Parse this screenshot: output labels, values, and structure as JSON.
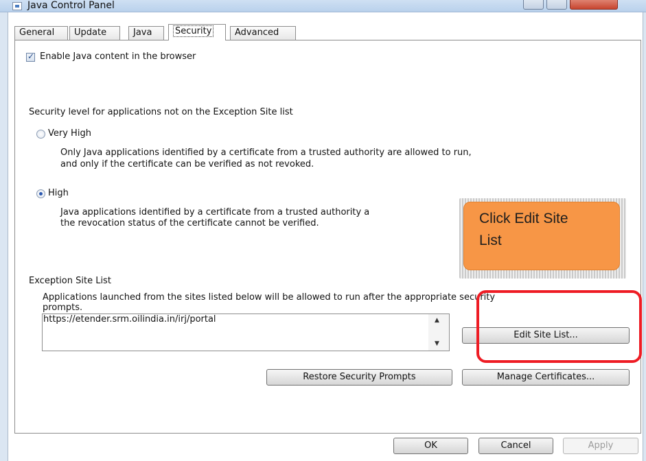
{
  "window": {
    "title": "Java Control Panel"
  },
  "tabs": {
    "general": "General",
    "update": "Update",
    "java": "Java",
    "security": "Security",
    "advanced": "Advanced"
  },
  "enable_java": {
    "label": "Enable Java content in the browser",
    "checked": true
  },
  "security_level": {
    "label": "Security level for applications not on the Exception Site list",
    "options": [
      {
        "label": "Very High",
        "selected": false,
        "desc1": "Only Java applications identified by a certificate from a trusted authority are allowed to run,",
        "desc2": "and only if the certificate can be verified as not revoked."
      },
      {
        "label": "High",
        "selected": true,
        "desc1": "Java applications identified by a certificate from a trusted authority a",
        "desc2": "the revocation status of the certificate cannot be verified."
      }
    ]
  },
  "exception_site_list": {
    "label": "Exception Site List",
    "desc1": "Applications launched from the sites listed below will be allowed to run after the appropriate security",
    "desc2": "prompts.",
    "sites": [
      "https://etender.srm.oilindia.in/irj/portal"
    ],
    "edit_button": "Edit Site List..."
  },
  "buttons": {
    "restore": "Restore Security Prompts",
    "manage_certs": "Manage Certificates...",
    "ok": "OK",
    "cancel": "Cancel",
    "apply": "Apply"
  },
  "annotation": {
    "line1": "Click Edit Site",
    "line2": "List",
    "color": "#f79646",
    "highlight_color": "#ee1c24"
  }
}
